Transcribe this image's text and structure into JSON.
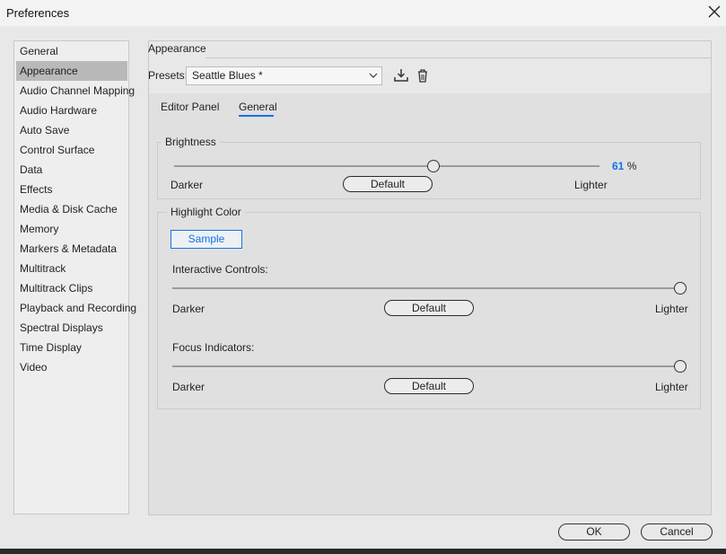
{
  "window": {
    "title": "Preferences"
  },
  "sidebar": {
    "items": [
      {
        "label": "General"
      },
      {
        "label": "Appearance",
        "selected": true
      },
      {
        "label": "Audio Channel Mapping"
      },
      {
        "label": "Audio Hardware"
      },
      {
        "label": "Auto Save"
      },
      {
        "label": "Control Surface"
      },
      {
        "label": "Data"
      },
      {
        "label": "Effects"
      },
      {
        "label": "Media & Disk Cache"
      },
      {
        "label": "Memory"
      },
      {
        "label": "Markers & Metadata"
      },
      {
        "label": "Multitrack"
      },
      {
        "label": "Multitrack Clips"
      },
      {
        "label": "Playback and Recording"
      },
      {
        "label": "Spectral Displays"
      },
      {
        "label": "Time Display"
      },
      {
        "label": "Video"
      }
    ]
  },
  "appearance": {
    "section_title": "Appearance",
    "presets_label": "Presets:",
    "preset_value": "Seattle Blues *",
    "tabs": [
      {
        "label": "Editor Panel"
      },
      {
        "label": "General",
        "active": true
      }
    ],
    "brightness": {
      "title": "Brightness",
      "value": "61",
      "unit": "%",
      "level": 0.61,
      "darker": "Darker",
      "lighter": "Lighter",
      "default_label": "Default"
    },
    "highlight": {
      "title": "Highlight Color",
      "sample_label": "Sample",
      "interactive": {
        "label": "Interactive Controls:",
        "level": 1.0,
        "darker": "Darker",
        "lighter": "Lighter",
        "default_label": "Default"
      },
      "focus": {
        "label": "Focus Indicators:",
        "level": 1.0,
        "darker": "Darker",
        "lighter": "Lighter",
        "default_label": "Default"
      }
    }
  },
  "footer": {
    "ok_label": "OK",
    "cancel_label": "Cancel"
  },
  "colors": {
    "accent": "#1473e6",
    "selected_item": "#b9b9b9"
  },
  "icons": [
    "close-icon",
    "chevron-down-icon",
    "download-icon",
    "trash-icon"
  ]
}
